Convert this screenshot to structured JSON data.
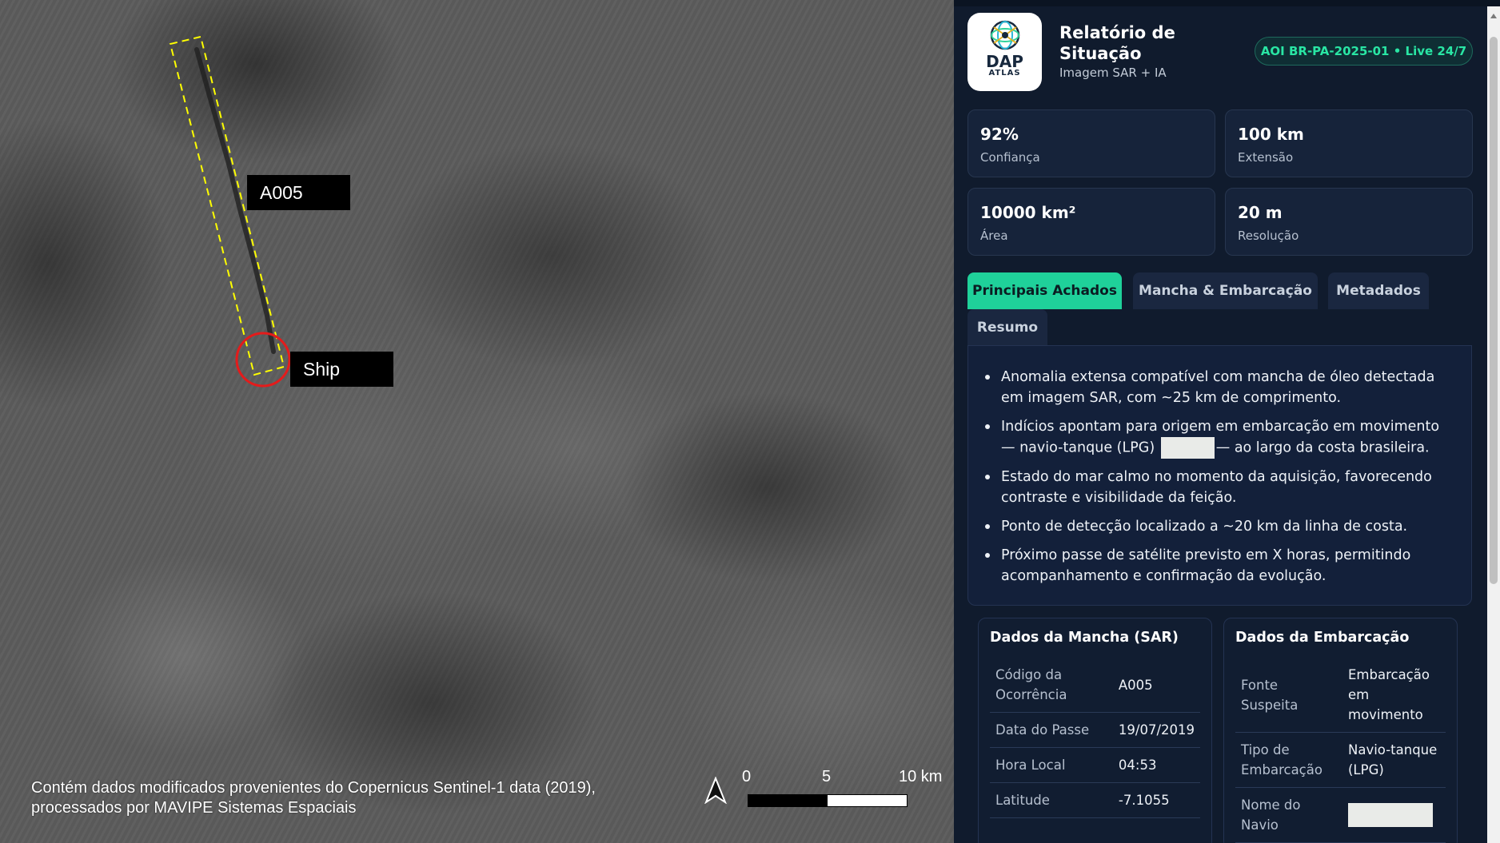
{
  "map": {
    "label_a005": "A005",
    "label_ship": "Ship",
    "attribution_line1": "Contém dados modificados provenientes do Copernicus Sentinel-1 data (2019),",
    "attribution_line2": "processados por MAVIPE Sistemas Espaciais",
    "scale": {
      "tick0": "0",
      "tick1": "5",
      "tick2": "10 km"
    },
    "north_arrow_icon": "north-arrow-icon",
    "colors": {
      "slick_box": "#ffff00",
      "ship_circle": "#e41b1b"
    }
  },
  "panel": {
    "logo": {
      "word": "DAP",
      "sub": "ATLAS",
      "icon": "globe-mesh-icon"
    },
    "title": "Relatório de Situação",
    "subtitle": "Imagem SAR + IA",
    "badge": "AOI BR-PA-2025-01 • Live 24/7",
    "stats": [
      {
        "value": "92%",
        "label": "Confiança"
      },
      {
        "value": "100 km",
        "label": "Extensão"
      },
      {
        "value": "10000 km²",
        "label": "Área"
      },
      {
        "value": "20 m",
        "label": "Resolução"
      }
    ],
    "tabs": [
      "Principais Achados",
      "Mancha & Embarcação",
      "Metadados",
      "Resumo"
    ],
    "active_tab": "Principais Achados",
    "findings": {
      "f1": "Anomalia extensa compatível com mancha de óleo detectada em imagem SAR, com ~25 km de comprimento.",
      "f2_before": "Indícios apontam para origem em embarcação em movimento — navio-tanque (LPG)",
      "f2_after": "— ao largo da costa brasileira.",
      "f3": "Estado do mar calmo no momento da aquisição, favorecendo contraste e visibilidade da feição.",
      "f4": "Ponto de detecção localizado a ~20 km da linha de costa.",
      "f5": "Próximo passe de satélite previsto em X horas, permitindo acompanhamento e confirmação da evolução."
    },
    "slick_card": {
      "title": "Dados da Mancha (SAR)",
      "rows": [
        {
          "key": "Código da Ocorrência",
          "value": "A005"
        },
        {
          "key": "Data do Passe",
          "value": "19/07/2019"
        },
        {
          "key": "Hora Local",
          "value": "04:53"
        },
        {
          "key": "Latitude",
          "value": "-7.1055"
        }
      ]
    },
    "vessel_card": {
      "title": "Dados da Embarcação",
      "rows": [
        {
          "key": "Fonte Suspeita",
          "value": "Embarcação em movimento"
        },
        {
          "key": "Tipo de Embarcação",
          "value": "Navio-tanque (LPG)"
        },
        {
          "key": "Nome do Navio",
          "value": ""
        }
      ]
    },
    "colors": {
      "accent": "#1fd19a",
      "badge_text": "#29e6a4",
      "background": "#101b2d"
    }
  }
}
